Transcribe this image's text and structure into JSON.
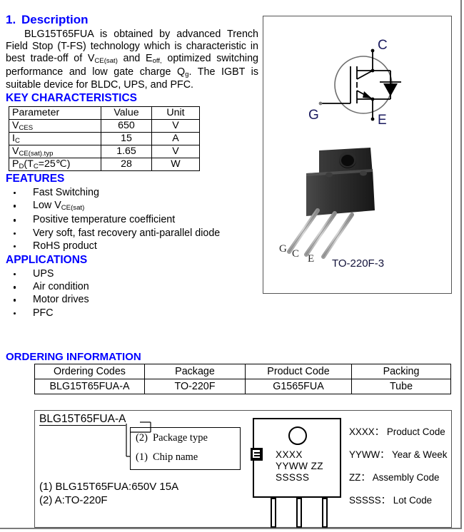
{
  "description": {
    "section_number": "1.",
    "title": "Description",
    "paragraph_html": "BLG15T65FUA is obtained by advanced Trench Field Stop (T-FS) technology which is characteristic in best trade-off of V<sub>CE(sat)</sub> and E<sub>off,</sub> optimized switching performance and low gate charge Q<sub>g</sub>. The IGBT is suitable device for BLDC, UPS, and PFC."
  },
  "key_characteristics": {
    "heading": "KEY CHARACTERISTICS",
    "columns": [
      "Parameter",
      "Value",
      "Unit"
    ],
    "rows": [
      {
        "parameter_html": "V<sub>CES</sub>",
        "value": "650",
        "unit": "V"
      },
      {
        "parameter_html": "I<sub>C</sub>",
        "value": "15",
        "unit": "A"
      },
      {
        "parameter_html": "V<sub>CE(sat).typ</sub>",
        "value": "1.65",
        "unit": "V"
      },
      {
        "parameter_html": "P<sub>D</sub>(T<sub>C</sub>=25℃)",
        "value": "28",
        "unit": "W"
      }
    ]
  },
  "features": {
    "heading": "FEATURES",
    "items_html": [
      "Fast Switching",
      "Low V<sub>CE(sat)</sub>",
      "Positive temperature coefficient",
      "Very soft, fast recovery anti-parallel diode",
      "RoHS product"
    ]
  },
  "applications": {
    "heading": "APPLICATIONS",
    "items_html": [
      "UPS",
      "Air condition",
      "Motor drives",
      "PFC"
    ]
  },
  "symbol_panel": {
    "symbol_name": "igbt-with-antiparallel-diode-symbol",
    "terminal_labels": {
      "collector": "C",
      "gate": "G",
      "emitter": "E"
    },
    "package_name": "to-220f-3-package-drawing",
    "package_pin_labels": [
      "G",
      "C",
      "E"
    ],
    "package_caption": "TO-220F-3",
    "label_color": "#1a1a5e"
  },
  "ordering_information": {
    "heading": "ORDERING INFORMATION",
    "columns": [
      "Ordering Codes",
      "Package",
      "Product Code",
      "Packing"
    ],
    "rows": [
      {
        "ordering_code": "BLG15T65FUA-A",
        "package": "TO-220F",
        "product_code": "G1565FUA",
        "packing": "Tube"
      }
    ]
  },
  "part_number_decoder": {
    "part_number": "BLG15T65FUA-A",
    "callouts": [
      {
        "index": "(2)",
        "label": "Package type"
      },
      {
        "index": "(1)",
        "label": "Chip name"
      }
    ],
    "notes": [
      "(1) BLG15T65FUA:650V 15A",
      "(2) A:TO-220F"
    ]
  },
  "marking_diagram": {
    "logo_name": "manufacturer-logo",
    "marking_lines": [
      "XXXX",
      "YYWW  ZZ",
      "SSSSS"
    ],
    "legend": [
      "XXXX： Product Code",
      "YYWW： Year & Week",
      "ZZ： Assembly Code",
      "SSSSS： Lot Code"
    ]
  },
  "colors": {
    "heading_blue": "#0000ff",
    "text_black": "#000000",
    "border_gray": "#555555"
  }
}
